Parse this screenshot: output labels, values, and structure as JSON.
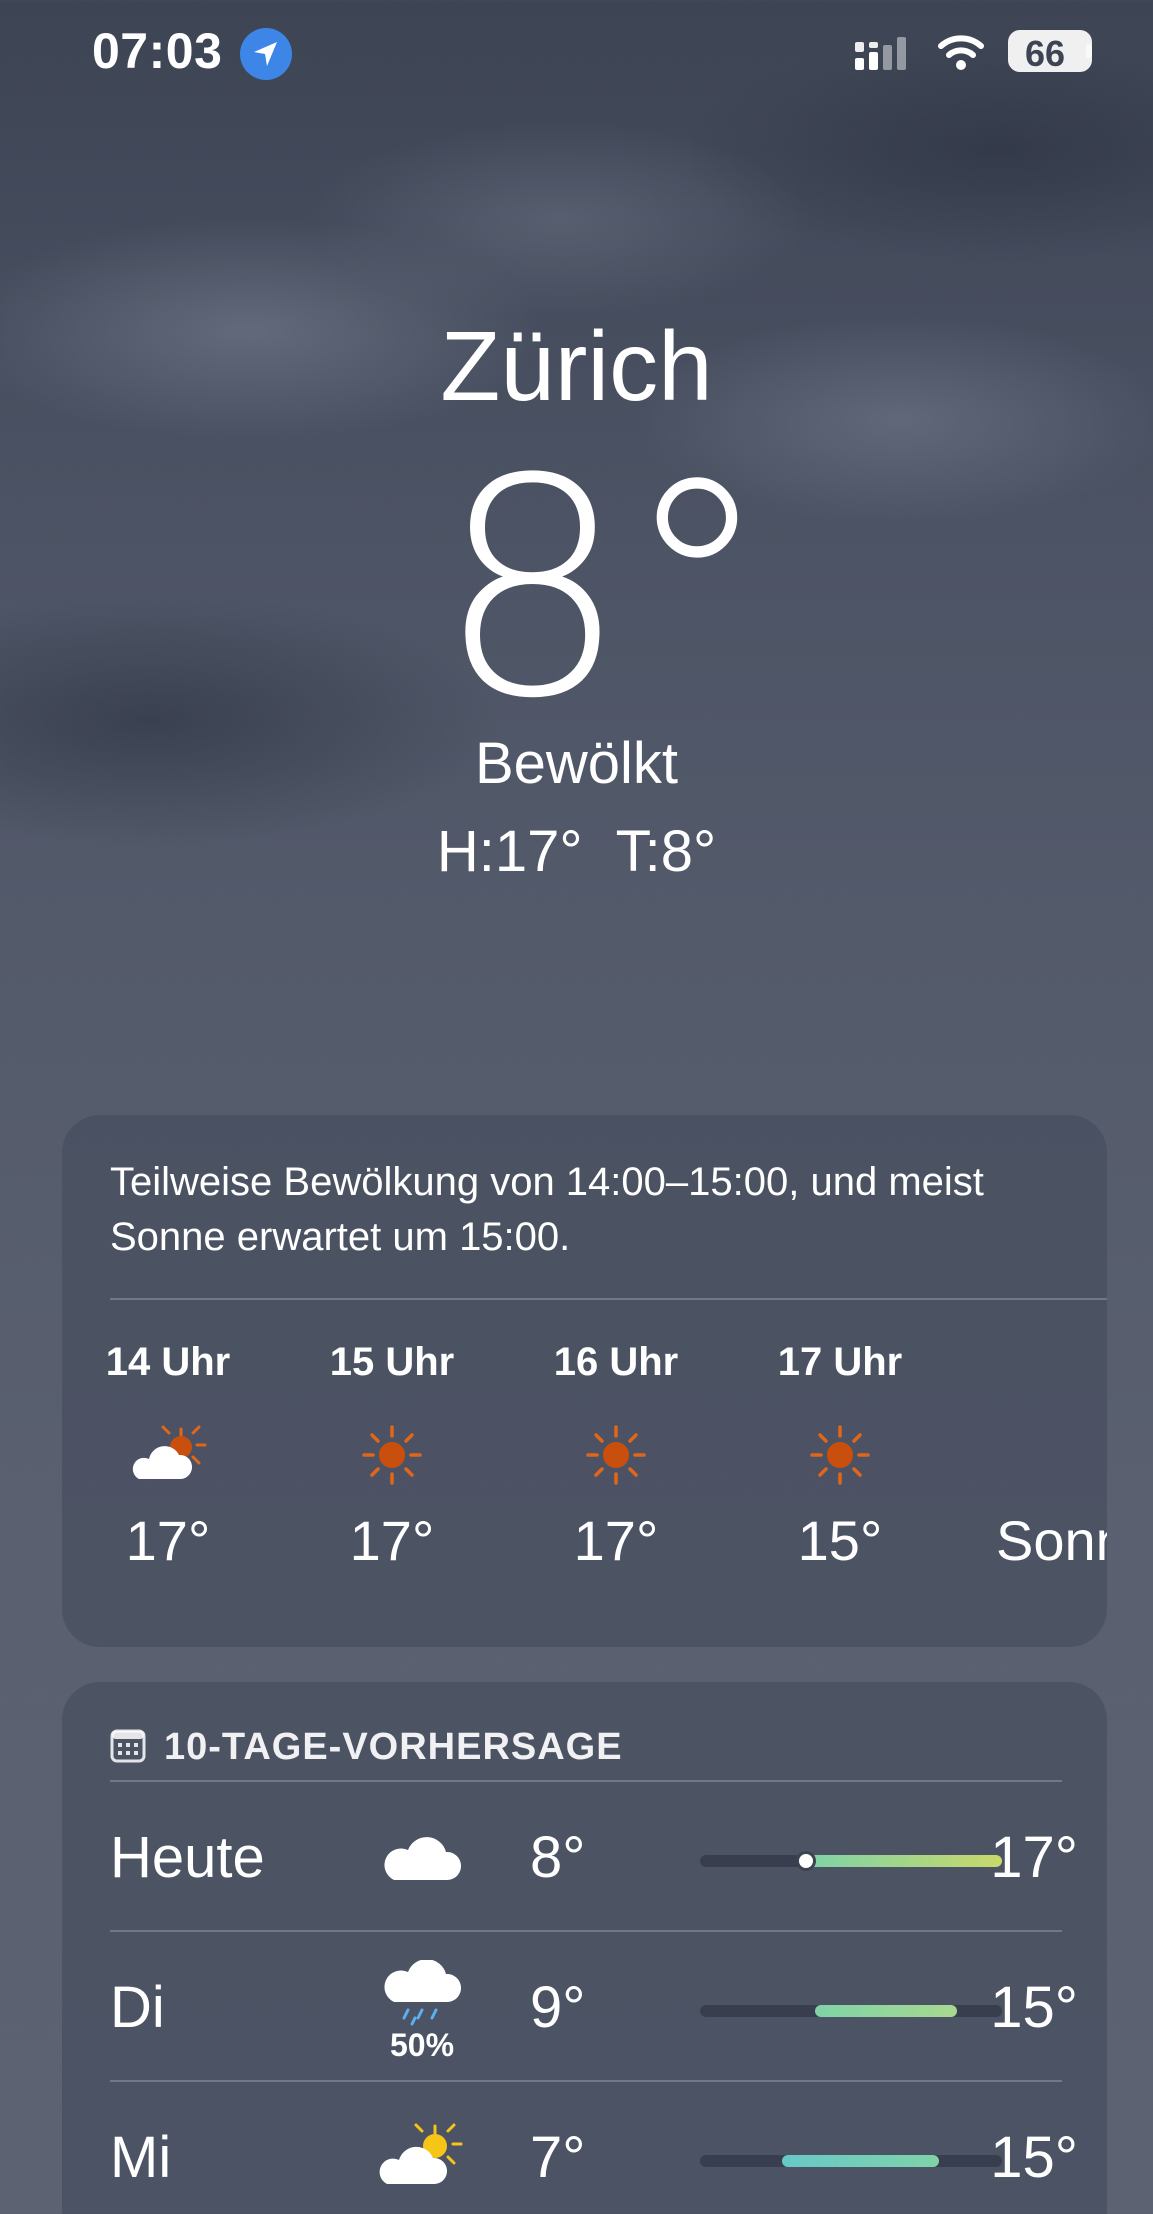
{
  "status_bar": {
    "time": "07:03",
    "location_icon": "location-arrow-icon",
    "signal_icon": "cellular-signal-icon",
    "wifi_icon": "wifi-icon",
    "battery": "66"
  },
  "current": {
    "city": "Zürich",
    "temperature": "8°",
    "condition": "Bewölkt",
    "high_low": "H:17° T:8°"
  },
  "hourly": {
    "summary": "Teilweise Bewölkung von 14:00–15:00, und meist Sonne erwartet um 15:00.",
    "items": [
      {
        "time": "14 Uhr",
        "icon": "partly-sunny-icon",
        "temp": "17°"
      },
      {
        "time": "15 Uhr",
        "icon": "sun-icon",
        "temp": "17°"
      },
      {
        "time": "16 Uhr",
        "icon": "sun-icon",
        "temp": "17°"
      },
      {
        "time": "17 Uhr",
        "icon": "sun-icon",
        "temp": "15°"
      },
      {
        "time": "",
        "icon": "",
        "temp": "Sonn"
      }
    ]
  },
  "daily": {
    "header_icon": "calendar-icon",
    "header": "10-TAGE-VORHERSAGE",
    "days": [
      {
        "day": "Heute",
        "icon": "cloud-icon",
        "precip": "",
        "low": "8°",
        "high": "17°",
        "bar_start": 0.36,
        "bar_end": 1.0,
        "current_marker": 0.35
      },
      {
        "day": "Di",
        "icon": "cloud-rain-icon",
        "precip": "50%",
        "low": "9°",
        "high": "15°",
        "bar_start": 0.38,
        "bar_end": 0.85
      },
      {
        "day": "Mi",
        "icon": "partly-sunny-icon",
        "precip": "",
        "low": "7°",
        "high": "15°",
        "bar_start": 0.27,
        "bar_end": 0.79
      }
    ]
  },
  "colors": {
    "sun": "#c8500c",
    "sun_rays": "#e0661a",
    "bar_warm": "#c9d86a",
    "bar_cool": "#7fd3a8",
    "bar_teal": "#67c8c8",
    "rain": "#5ab0f0",
    "location_badge": "#3d86e8"
  }
}
